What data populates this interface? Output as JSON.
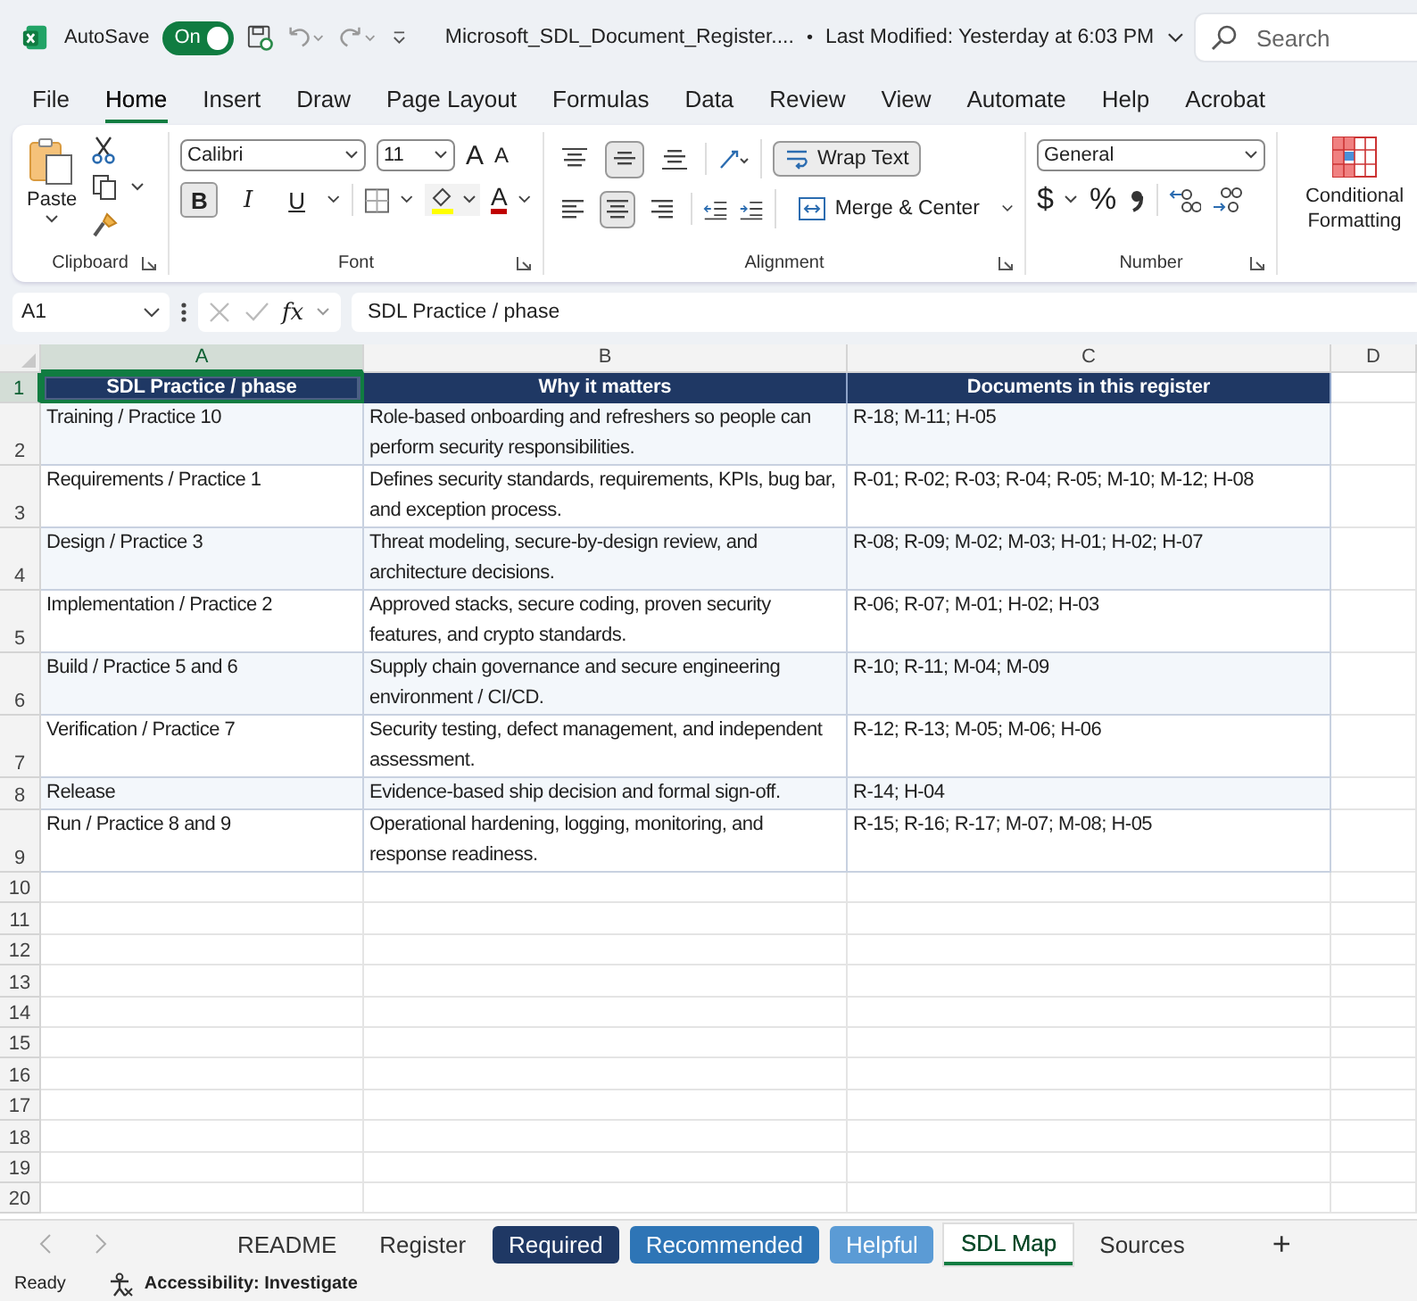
{
  "title_bar": {
    "autosave_label": "AutoSave",
    "autosave_toggle": {
      "label": "On",
      "on": true
    },
    "file_name": "Microsoft_SDL_Document_Register....",
    "separator": "•",
    "modified": "Last Modified: Yesterday at 6:03 PM",
    "search": {
      "placeholder": "Search"
    }
  },
  "menu_tabs": [
    {
      "label": "File",
      "selected": false
    },
    {
      "label": "Home",
      "selected": true
    },
    {
      "label": "Insert",
      "selected": false
    },
    {
      "label": "Draw",
      "selected": false
    },
    {
      "label": "Page Layout",
      "selected": false
    },
    {
      "label": "Formulas",
      "selected": false
    },
    {
      "label": "Data",
      "selected": false
    },
    {
      "label": "Review",
      "selected": false
    },
    {
      "label": "View",
      "selected": false
    },
    {
      "label": "Automate",
      "selected": false
    },
    {
      "label": "Help",
      "selected": false
    },
    {
      "label": "Acrobat",
      "selected": false
    }
  ],
  "ribbon": {
    "clipboard": {
      "paste": "Paste",
      "label": "Clipboard"
    },
    "font": {
      "name": "Calibri",
      "size": "11",
      "grow": "A",
      "shrink": "A",
      "styles": [
        {
          "label": "B",
          "kind": "bold",
          "selected": true
        },
        {
          "label": "I",
          "kind": "italic",
          "selected": false
        },
        {
          "label": "U",
          "kind": "underline",
          "selected": false
        }
      ],
      "font_color": "A",
      "label": "Font"
    },
    "alignment": {
      "vertical": [
        {
          "kind": "top",
          "selected": false
        },
        {
          "kind": "middle",
          "selected": true
        },
        {
          "kind": "bottom",
          "selected": false
        }
      ],
      "horizontal": [
        {
          "kind": "left",
          "selected": false
        },
        {
          "kind": "center",
          "selected": true
        },
        {
          "kind": "right",
          "selected": false
        }
      ],
      "wrap_text": {
        "label": "Wrap Text",
        "selected": true
      },
      "merge": "Merge & Center",
      "label": "Alignment"
    },
    "number": {
      "format": "General",
      "currency": "$",
      "percent": "%",
      "label": "Number"
    },
    "styles": {
      "conditional": "Conditional Formatting"
    }
  },
  "formula_bar": {
    "name_box": "A1",
    "fx": "fx",
    "formula": "SDL Practice / phase"
  },
  "sheet": {
    "columns": [
      {
        "label": "A",
        "selected": true
      },
      {
        "label": "B",
        "selected": false
      },
      {
        "label": "C",
        "selected": false
      },
      {
        "label": "D",
        "selected": false
      }
    ],
    "header_row": {
      "number": "1",
      "selected": true,
      "cells": [
        "SDL Practice / phase",
        "Why it matters",
        "Documents in this register"
      ]
    },
    "rows": [
      {
        "number": "2",
        "shaded": true,
        "cells": [
          "Training / Practice 10",
          "Role-based onboarding and refreshers so people can perform security responsibilities.",
          "R-18; M-11; H-05"
        ]
      },
      {
        "number": "3",
        "shaded": false,
        "cells": [
          "Requirements / Practice 1",
          "Defines security standards, requirements, KPIs, bug bar, and exception process.",
          "R-01; R-02; R-03; R-04; R-05; M-10; M-12; H-08"
        ]
      },
      {
        "number": "4",
        "shaded": true,
        "cells": [
          "Design / Practice 3",
          "Threat modeling, secure-by-design review, and architecture decisions.",
          "R-08; R-09; M-02; M-03; H-01; H-02; H-07"
        ]
      },
      {
        "number": "5",
        "shaded": false,
        "cells": [
          "Implementation / Practice 2",
          "Approved stacks, secure coding, proven security features, and crypto standards.",
          "R-06; R-07; M-01; H-02; H-03"
        ]
      },
      {
        "number": "6",
        "shaded": true,
        "cells": [
          "Build / Practice 5 and 6",
          "Supply chain governance and secure engineering environment / CI/CD.",
          "R-10; R-11; M-04; M-09"
        ]
      },
      {
        "number": "7",
        "shaded": false,
        "cells": [
          "Verification / Practice 7",
          "Security testing, defect management, and independent assessment.",
          "R-12; R-13; M-05; M-06; H-06"
        ]
      },
      {
        "number": "8",
        "shaded": true,
        "cells": [
          "Release",
          "Evidence-based ship decision and formal sign-off.",
          "R-14; H-04"
        ]
      },
      {
        "number": "9",
        "shaded": false,
        "cells": [
          "Run / Practice 8 and 9",
          "Operational hardening, logging, monitoring, and response readiness.",
          "R-15; R-16; R-17; M-07; M-08; H-05"
        ]
      }
    ],
    "empty_rows": [
      "10",
      "11",
      "12",
      "13",
      "14",
      "15",
      "16",
      "17",
      "18",
      "19",
      "20"
    ]
  },
  "sheet_tabs": [
    {
      "label": "README",
      "selected": false
    },
    {
      "label": "Register",
      "selected": false
    },
    {
      "label": "Required",
      "selected": false,
      "color": "#1f3864"
    },
    {
      "label": "Recommended",
      "selected": false,
      "color": "#2e75b6"
    },
    {
      "label": "Helpful",
      "selected": false,
      "color": "#5b9bd5"
    },
    {
      "label": "SDL Map",
      "selected": true
    },
    {
      "label": "Sources",
      "selected": false
    }
  ],
  "add_sheet": "+",
  "status_bar": {
    "ready": "Ready",
    "accessibility": "Accessibility: Investigate"
  }
}
